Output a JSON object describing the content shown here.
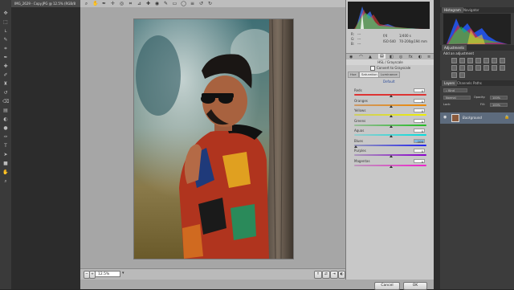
{
  "ps_doc_tab": "IMG_2629 - Copy.JPG @ 12.5% (RGB/8",
  "toolbar_icons": [
    "move-icon",
    "marquee-icon",
    "lasso-icon",
    "quick-select-icon",
    "crop-icon",
    "eyedropper-icon",
    "healing-icon",
    "brush-icon",
    "stamp-icon",
    "history-brush-icon",
    "eraser-icon",
    "gradient-icon",
    "blur-icon",
    "dodge-icon",
    "pen-icon",
    "type-icon",
    "path-select-icon",
    "shape-icon",
    "hand-icon",
    "zoom-icon"
  ],
  "acr_tools": [
    "zoom-icon",
    "hand-icon",
    "white-balance-icon",
    "color-sampler-icon",
    "targeted-adjust-icon",
    "crop-icon",
    "straighten-icon",
    "spot-removal-icon",
    "red-eye-icon",
    "adjustment-brush-icon",
    "graduated-filter-icon",
    "radial-filter-icon",
    "preferences-icon",
    "rotate-left-icon",
    "rotate-right-icon"
  ],
  "zoom_level": "12.5%",
  "camera_info": {
    "aperture": "f/4",
    "shutter": "1/400 s",
    "iso": "ISO 640",
    "lens": "70-200@194 mm",
    "r": "R:",
    "g": "G:",
    "b": "B:",
    "r_val": "---",
    "g_val": "---",
    "b_val": "---"
  },
  "panel_title": "HSL / Grayscale",
  "convert_grayscale": "Convert to Grayscale",
  "subtabs": [
    "Hue",
    "Saturation",
    "Luminance"
  ],
  "active_subtab": "Saturation",
  "default_link": "Default",
  "sliders": [
    {
      "label": "Reds",
      "value": "0",
      "colors": [
        "#d33",
        "#d33"
      ],
      "pos": 0.5
    },
    {
      "label": "Oranges",
      "value": "0",
      "colors": [
        "#c96",
        "#e80"
      ],
      "pos": 0.5
    },
    {
      "label": "Yellows",
      "value": "0",
      "colors": [
        "#cc6",
        "#ee0"
      ],
      "pos": 0.5
    },
    {
      "label": "Greens",
      "value": "0",
      "colors": [
        "#9b9",
        "#2b2"
      ],
      "pos": 0.5
    },
    {
      "label": "Aquas",
      "value": "0",
      "colors": [
        "#9cc",
        "#0dd"
      ],
      "pos": 0.5
    },
    {
      "label": "Blues",
      "value": "-100",
      "colors": [
        "#99b",
        "#22e"
      ],
      "pos": 0.0
    },
    {
      "label": "Purples",
      "value": "0",
      "colors": [
        "#a9b",
        "#80c"
      ],
      "pos": 0.5
    },
    {
      "label": "Magentas",
      "value": "0",
      "colors": [
        "#b9b",
        "#e2c"
      ],
      "pos": 0.5
    }
  ],
  "buttons": {
    "cancel": "Cancel",
    "ok": "OK"
  },
  "ps_panels": {
    "top_tabs": [
      "Histogram",
      "Navigator"
    ],
    "adjustments_tab": "Adjustments",
    "adjustments_label": "Add an adjustment",
    "layers_tabs": [
      "Layers",
      "Channels",
      "Paths"
    ],
    "blend_mode": "Normal",
    "opacity_label": "Opacity:",
    "opacity_value": "100%",
    "fill_label": "Fill:",
    "fill_value": "100%",
    "lock_label": "Lock:",
    "kind": "Kind",
    "layer_name": "Background"
  },
  "colors": {
    "accent_blue": "#5d6b7d",
    "blue_value_highlight": "#7fb7e0"
  }
}
